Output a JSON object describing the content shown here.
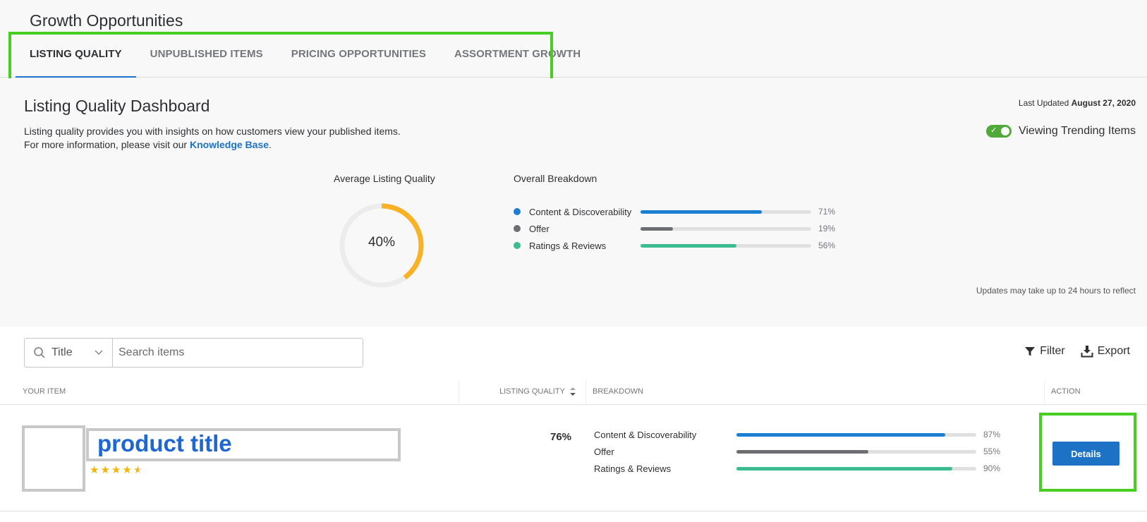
{
  "header": {
    "title": "Growth Opportunities",
    "tabs": [
      {
        "label": "LISTING QUALITY",
        "active": true
      },
      {
        "label": "UNPUBLISHED ITEMS",
        "active": false
      },
      {
        "label": "PRICING OPPORTUNITIES",
        "active": false
      },
      {
        "label": "ASSORTMENT GROWTH",
        "active": false
      }
    ]
  },
  "dashboard": {
    "title": "Listing Quality Dashboard",
    "desc_line1": "Listing quality provides you with insights on how customers view your published items.",
    "desc_line2_prefix": "For more information, please visit our",
    "desc_link": "Knowledge Base",
    "desc_line2_suffix": ".",
    "last_updated_label": "Last Updated",
    "last_updated_date": "August 27, 2020",
    "toggle_label": "Viewing Trending Items",
    "toggle_on": true,
    "average_label": "Average Listing Quality",
    "average_value": "40%",
    "average_fraction": 0.4,
    "breakdown_title": "Overall Breakdown",
    "breakdown": [
      {
        "label": "Content & Discoverability",
        "pct": "71%",
        "value": 71,
        "color": "#1d7fd1"
      },
      {
        "label": "Offer",
        "pct": "19%",
        "value": 19,
        "color": "#6d6e71"
      },
      {
        "label": "Ratings & Reviews",
        "pct": "56%",
        "value": 56,
        "color": "#3dbb91"
      }
    ],
    "updates_note": "Updates may take up to 24 hours to reflect"
  },
  "toolbar": {
    "search_type": "Title",
    "search_placeholder": "Search items",
    "filter_label": "Filter",
    "export_label": "Export"
  },
  "table": {
    "headers": {
      "item": "YOUR ITEM",
      "quality": "LISTING QUALITY",
      "breakdown": "BREAKDOWN",
      "action": "ACTION"
    },
    "rows": [
      {
        "title": "product title",
        "stars": "★★★★★",
        "rating": 4.5,
        "quality": "76%",
        "breakdown": [
          {
            "label": "Content & Discoverability",
            "pct": "87%",
            "value": 87,
            "color": "#1d7fd1"
          },
          {
            "label": "Offer",
            "pct": "55%",
            "value": 55,
            "color": "#6d6e71"
          },
          {
            "label": "Ratings & Reviews",
            "pct": "90%",
            "value": 90,
            "color": "#3dbb91"
          }
        ],
        "action_label": "Details"
      }
    ]
  },
  "colors": {
    "accent": "#1d72c5",
    "highlight": "#46cf22",
    "donut": "#fbb124",
    "toggle": "#4faa3a",
    "star": "#f6b400"
  }
}
